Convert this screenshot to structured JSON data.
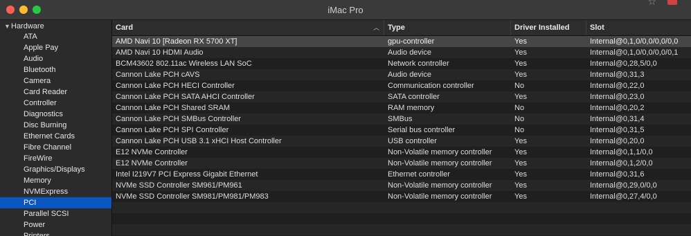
{
  "window": {
    "title": "iMac Pro",
    "controls": [
      "close",
      "minimize",
      "maximize"
    ],
    "extra_icons": [
      "star-icon",
      "close-icon"
    ]
  },
  "sidebar": {
    "header": "Hardware",
    "items": [
      "ATA",
      "Apple Pay",
      "Audio",
      "Bluetooth",
      "Camera",
      "Card Reader",
      "Controller",
      "Diagnostics",
      "Disc Burning",
      "Ethernet Cards",
      "Fibre Channel",
      "FireWire",
      "Graphics/Displays",
      "Memory",
      "NVMExpress",
      "PCI",
      "Parallel SCSI",
      "Power",
      "Printers"
    ],
    "selected": "PCI"
  },
  "table": {
    "columns": [
      "Card",
      "Type",
      "Driver Installed",
      "Slot"
    ],
    "sorted_by": "Card",
    "rows": [
      {
        "card": "AMD Navi 10 [Radeon RX 5700 XT]",
        "type": "gpu-controller",
        "driver": "Yes",
        "slot": "Internal@0,1,0/0,0/0,0/0,0"
      },
      {
        "card": "AMD Navi 10 HDMI Audio",
        "type": "Audio device",
        "driver": "Yes",
        "slot": "Internal@0,1,0/0,0/0,0/0,1"
      },
      {
        "card": "BCM43602 802.11ac Wireless LAN SoC",
        "type": "Network controller",
        "driver": "Yes",
        "slot": "Internal@0,28,5/0,0"
      },
      {
        "card": "Cannon Lake PCH cAVS",
        "type": "Audio device",
        "driver": "Yes",
        "slot": "Internal@0,31,3"
      },
      {
        "card": "Cannon Lake PCH HECI Controller",
        "type": "Communication controller",
        "driver": "No",
        "slot": "Internal@0,22,0"
      },
      {
        "card": "Cannon Lake PCH SATA AHCI Controller",
        "type": "SATA controller",
        "driver": "Yes",
        "slot": "Internal@0,23,0"
      },
      {
        "card": "Cannon Lake PCH Shared SRAM",
        "type": "RAM memory",
        "driver": "No",
        "slot": "Internal@0,20,2"
      },
      {
        "card": "Cannon Lake PCH SMBus Controller",
        "type": "SMBus",
        "driver": "No",
        "slot": "Internal@0,31,4"
      },
      {
        "card": "Cannon Lake PCH SPI Controller",
        "type": "Serial bus controller",
        "driver": "No",
        "slot": "Internal@0,31,5"
      },
      {
        "card": "Cannon Lake PCH USB 3.1 xHCI Host Controller",
        "type": "USB controller",
        "driver": "Yes",
        "slot": "Internal@0,20,0"
      },
      {
        "card": "E12 NVMe Controller",
        "type": "Non-Volatile memory controller",
        "driver": "Yes",
        "slot": "Internal@0,1,1/0,0"
      },
      {
        "card": "E12 NVMe Controller",
        "type": "Non-Volatile memory controller",
        "driver": "Yes",
        "slot": "Internal@0,1,2/0,0"
      },
      {
        "card": "Intel I219V7 PCI Express Gigabit Ethernet",
        "type": "Ethernet controller",
        "driver": "Yes",
        "slot": "Internal@0,31,6"
      },
      {
        "card": "NVMe SSD Controller SM961/PM961",
        "type": "Non-Volatile memory controller",
        "driver": "Yes",
        "slot": "Internal@0,29,0/0,0"
      },
      {
        "card": "NVMe SSD Controller SM981/PM981/PM983",
        "type": "Non-Volatile memory controller",
        "driver": "Yes",
        "slot": "Internal@0,27,4/0,0"
      }
    ]
  },
  "colors": {
    "selection_blue": "#0a56c2",
    "selected_row": "#464646",
    "traffic_close": "#fe5f57",
    "traffic_min": "#febc2e",
    "traffic_max": "#28c840"
  }
}
